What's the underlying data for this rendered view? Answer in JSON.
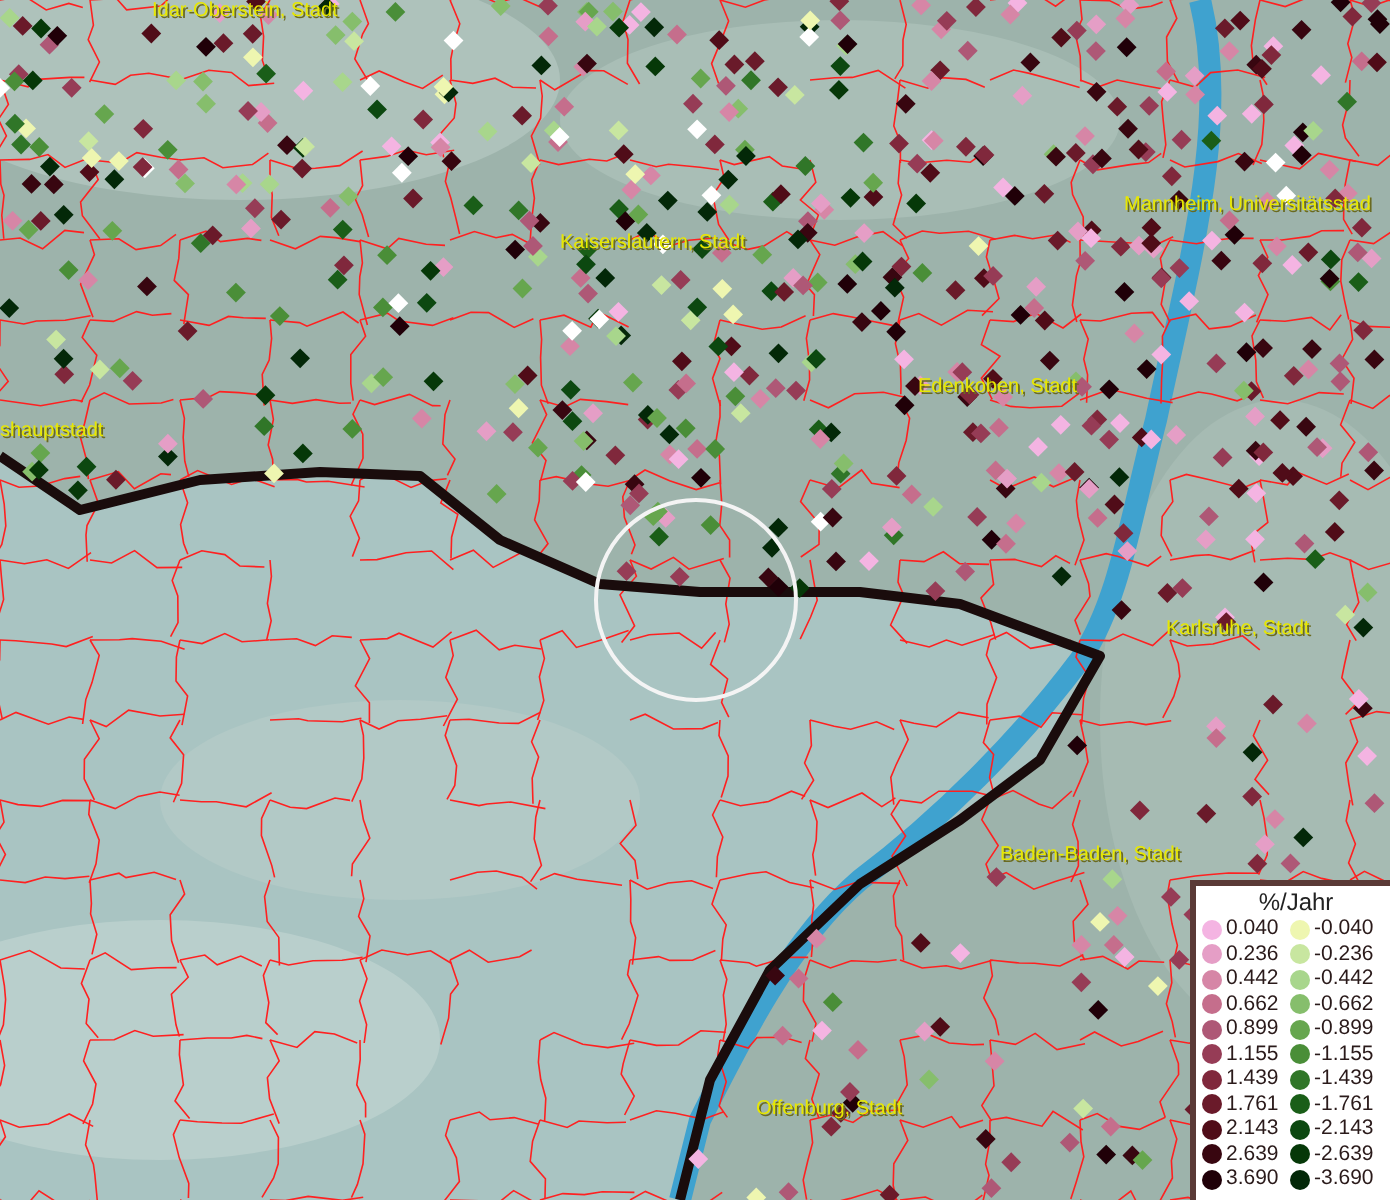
{
  "map": {
    "places": [
      {
        "name": "Idar-Oberstein, Stadt"
      },
      {
        "name": "Kaiserslautern, Stadt"
      },
      {
        "name": "Mannheim, Universitätsstad"
      },
      {
        "name": "Edenkoben, Stadt"
      },
      {
        "name": "shauptstadt"
      },
      {
        "name": "Karlsruhe, Stadt"
      },
      {
        "name": "Baden-Baden, Stadt"
      },
      {
        "name": "Offenburg, Stadt"
      }
    ]
  },
  "legend": {
    "title": "%/Jahr",
    "rows": [
      {
        "positive": {
          "label": "0.040",
          "color": "#f4b4e2"
        },
        "negative": {
          "label": "-0.040",
          "color": "#eef6b0"
        }
      },
      {
        "positive": {
          "label": "0.236",
          "color": "#e59ec6"
        },
        "negative": {
          "label": "-0.236",
          "color": "#c8e6a0"
        }
      },
      {
        "positive": {
          "label": "0.442",
          "color": "#d686a6"
        },
        "negative": {
          "label": "-0.442",
          "color": "#a8d68c"
        }
      },
      {
        "positive": {
          "label": "0.662",
          "color": "#c56e8c"
        },
        "negative": {
          "label": "-0.662",
          "color": "#86be6c"
        }
      },
      {
        "positive": {
          "label": "0.899",
          "color": "#ae5876"
        },
        "negative": {
          "label": "-0.899",
          "color": "#66a64e"
        }
      },
      {
        "positive": {
          "label": "1.155",
          "color": "#963c56"
        },
        "negative": {
          "label": "-1.155",
          "color": "#4a8e38"
        }
      },
      {
        "positive": {
          "label": "1.439",
          "color": "#80283c"
        },
        "negative": {
          "label": "-1.439",
          "color": "#307628"
        }
      },
      {
        "positive": {
          "label": "1.761",
          "color": "#6a1a2a"
        },
        "negative": {
          "label": "-1.761",
          "color": "#1a5e18"
        }
      },
      {
        "positive": {
          "label": "2.143",
          "color": "#500c18"
        },
        "negative": {
          "label": "-2.143",
          "color": "#0c4810"
        }
      },
      {
        "positive": {
          "label": "2.639",
          "color": "#380610"
        },
        "negative": {
          "label": "-2.639",
          "color": "#063808"
        }
      },
      {
        "positive": {
          "label": "3.690",
          "color": "#200008"
        },
        "negative": {
          "label": "-3.690",
          "color": "#032808"
        }
      }
    ]
  }
}
